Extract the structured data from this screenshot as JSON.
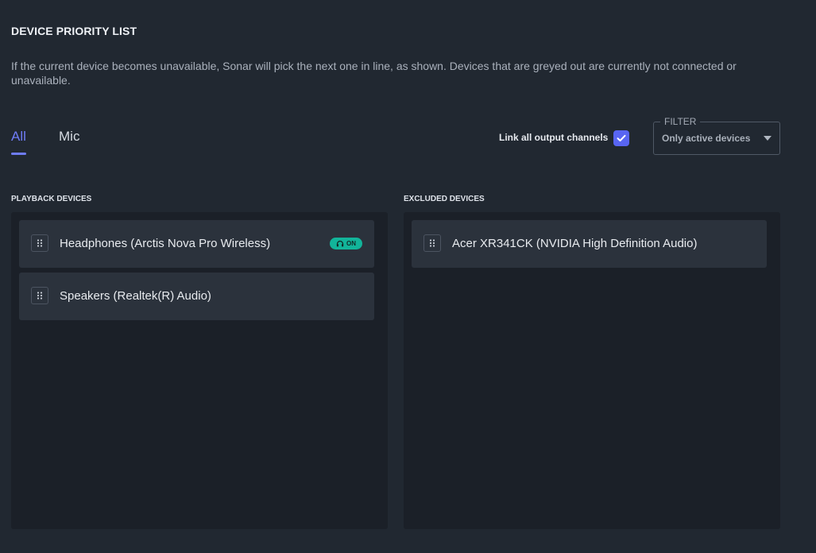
{
  "header": {
    "title": "DEVICE PRIORITY LIST",
    "description": "If the current device becomes unavailable, Sonar will pick the next one in line, as shown. Devices that are greyed out are currently not connected or unavailable."
  },
  "tabs": [
    {
      "label": "All",
      "active": true
    },
    {
      "label": "Mic",
      "active": false
    }
  ],
  "link_channels": {
    "label": "Link all output channels",
    "checked": true
  },
  "filter": {
    "legend": "FILTER",
    "selected": "Only active devices"
  },
  "playback": {
    "title": "PLAYBACK DEVICES",
    "devices": [
      {
        "label": "Headphones (Arctis Nova Pro Wireless)",
        "badge": "ON"
      },
      {
        "label": "Speakers (Realtek(R) Audio)"
      }
    ]
  },
  "excluded": {
    "title": "EXCLUDED DEVICES",
    "devices": [
      {
        "label": "Acer XR341CK (NVIDIA High Definition Audio)"
      }
    ]
  },
  "colors": {
    "background": "#212831",
    "panel": "#1b2028",
    "row": "#2b323c",
    "accent": "#6f7cf6",
    "checkbox": "#5865f2",
    "on_badge": "#12b49a"
  },
  "icons": {
    "drag_handle": "drag-handle-icon",
    "headphones": "headphones-icon",
    "check": "check-icon",
    "dropdown": "chevron-down-icon"
  }
}
